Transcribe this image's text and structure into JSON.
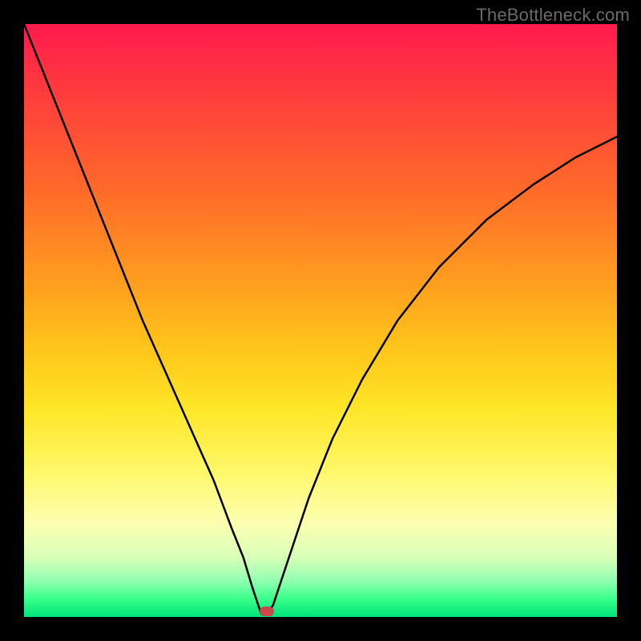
{
  "watermark": "TheBottleneck.com",
  "chart_data": {
    "type": "line",
    "title": "",
    "xlabel": "",
    "ylabel": "",
    "xlim": [
      0,
      100
    ],
    "ylim": [
      0,
      100
    ],
    "grid": false,
    "legend": false,
    "notch_x_percent": 40,
    "marker": {
      "x_percent": 41,
      "y_percent": 99
    },
    "series": [
      {
        "name": "bottleneck-curve",
        "x": [
          0,
          4,
          8,
          12,
          16,
          20,
          24,
          28,
          32,
          35,
          37,
          38.5,
          39.5,
          40,
          41,
          42,
          43,
          45,
          48,
          52,
          57,
          63,
          70,
          78,
          86,
          93,
          100
        ],
        "y": [
          100,
          90,
          80,
          70,
          60,
          50,
          41,
          32,
          23,
          15,
          10,
          5,
          2,
          0.5,
          0.5,
          2,
          5,
          11,
          20,
          30,
          40,
          50,
          59,
          67,
          73,
          77.5,
          81
        ]
      }
    ]
  }
}
